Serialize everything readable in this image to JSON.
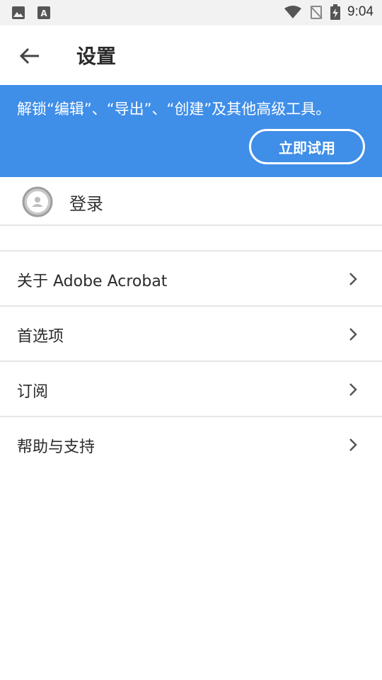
{
  "status_bar": {
    "time": "9:04",
    "icons": [
      "image-icon",
      "font-icon",
      "wifi-icon",
      "no-signal-icon",
      "battery-charging-icon"
    ]
  },
  "app_bar": {
    "title": "设置",
    "back_icon": "arrow-left-icon"
  },
  "promo": {
    "message": "解锁“编辑”、“导出”、“创建”及其他高级工具。",
    "button_label": "立即试用",
    "color": "#3f8ee8"
  },
  "account": {
    "label": "登录",
    "icon": "user-avatar-icon"
  },
  "menu": [
    {
      "label": "关于 Adobe Acrobat"
    },
    {
      "label": "首选项"
    },
    {
      "label": "订阅"
    },
    {
      "label": "帮助与支持"
    }
  ]
}
